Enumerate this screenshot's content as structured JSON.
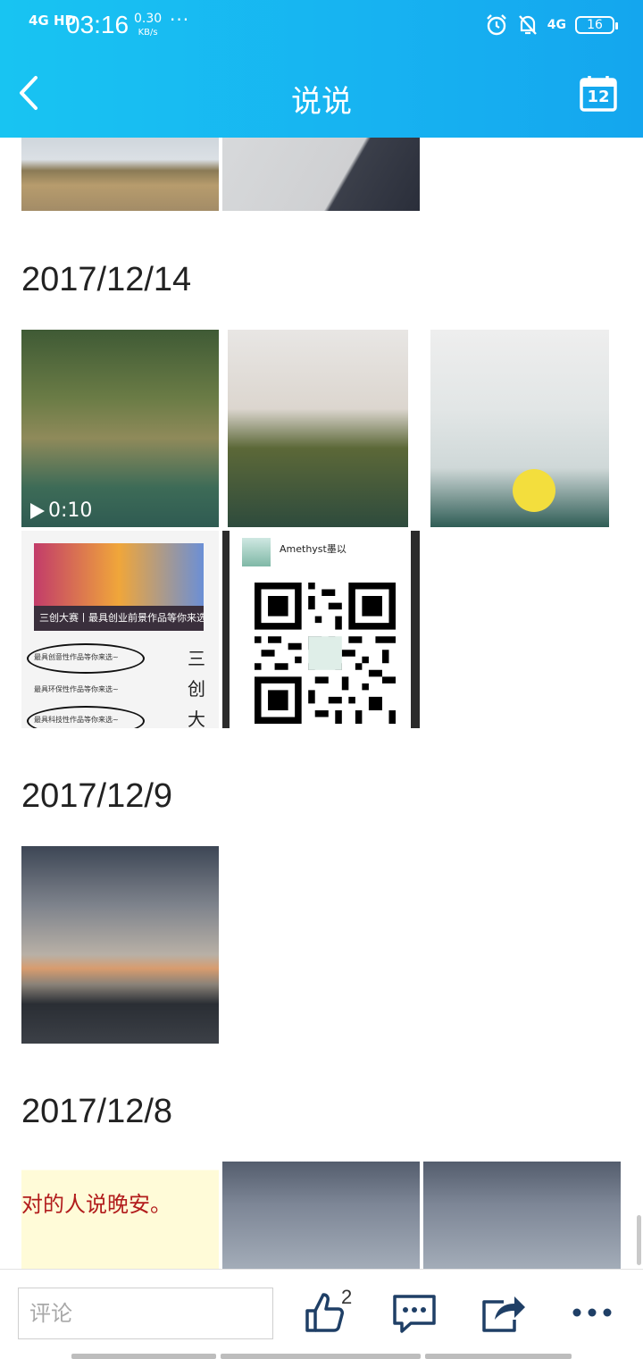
{
  "status_bar": {
    "network": "4G HD",
    "time": "03:16",
    "speed_value": "0.30",
    "speed_unit": "KB/s",
    "more": "···",
    "net_right": "4G",
    "battery": "16"
  },
  "header": {
    "title": "说说",
    "calendar_day": "12"
  },
  "sections": [
    {
      "date": "2017/12/14"
    },
    {
      "date": "2017/12/9"
    },
    {
      "date": "2017/12/8"
    }
  ],
  "photos": {
    "video_duration": "0:10",
    "poster_bar": "三创大赛丨最具创业前景作品等你来选",
    "poster_lines": [
      "最具创意性作品等你来选~",
      "最具环保性作品等你来选~",
      "最具科技性作品等你来选~"
    ],
    "poster_vertical": [
      "三",
      "创",
      "大"
    ],
    "qr_name": "Amethyst墨以",
    "text_caption": "对的人说晚安。"
  },
  "bottom": {
    "comment_placeholder": "评论",
    "like_count": "2"
  },
  "colors": {
    "header_blue": "#17b2f1",
    "icon_blue": "#1f3f66"
  }
}
